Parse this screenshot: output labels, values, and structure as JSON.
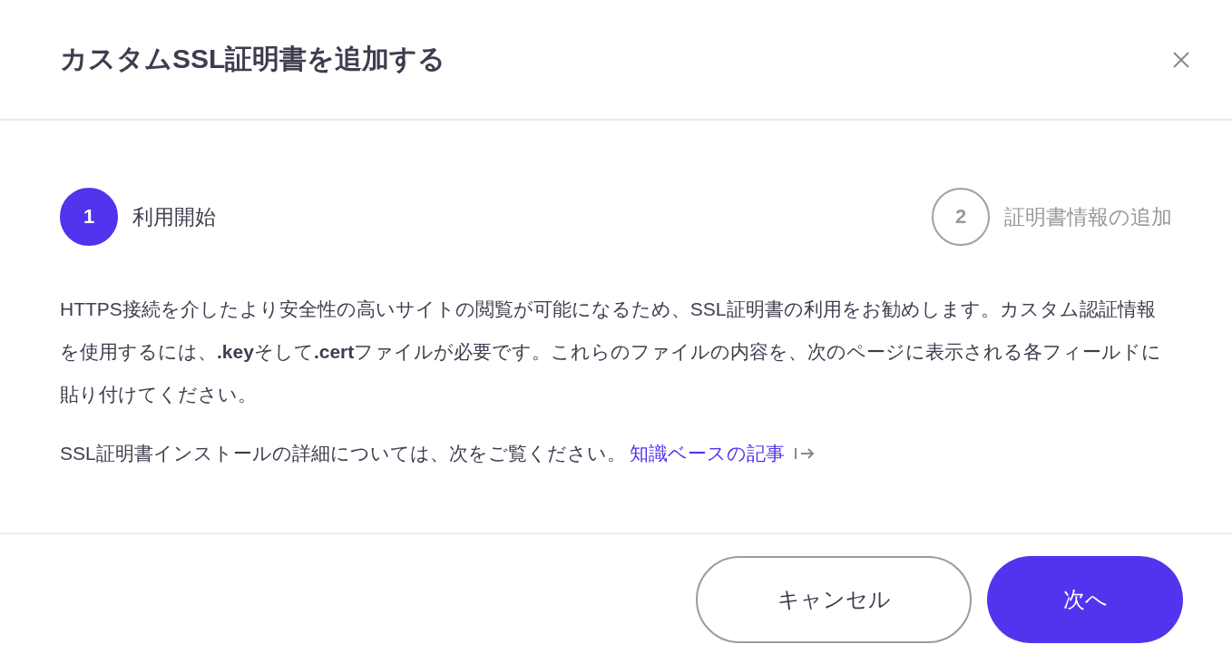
{
  "dialog": {
    "title": "カスタムSSL証明書を追加する"
  },
  "steps": [
    {
      "number": "1",
      "label": "利用開始",
      "selected": true
    },
    {
      "number": "2",
      "label": "証明書情報の追加",
      "selected": false
    }
  ],
  "body": {
    "paragraph": "HTTPS接続を介したより安全性の高いサイトの閲覧が可能になるため、SSL証明書の利用をお勧めします。カスタム認証情報を使用するには、**.key**そして**.cert**ファイルが必要です。これらのファイルの内容を、次のページに表示される各フィールドに貼り付けてください。",
    "more_info": "SSL証明書インストールの詳細については、次をご覧ください。",
    "link": "知識ベースの記事"
  },
  "buttons": [
    {
      "label": "キャンセル",
      "kind": "secondary"
    },
    {
      "label": "次へ",
      "kind": "primary"
    }
  ]
}
